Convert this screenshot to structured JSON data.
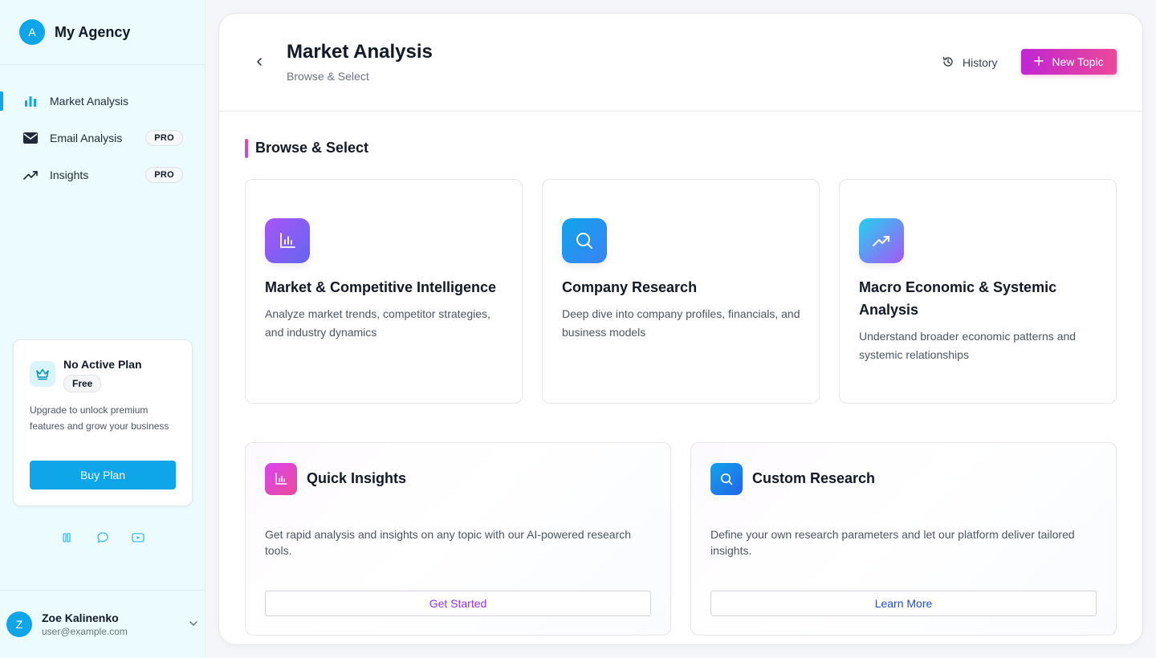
{
  "brand": {
    "initial": "A",
    "name": "My Agency"
  },
  "sidebar": {
    "items": [
      {
        "label": "Market Analysis",
        "icon": "bar-chart-icon",
        "active": true,
        "badge": ""
      },
      {
        "label": "Email Analysis",
        "icon": "mail-icon",
        "active": false,
        "badge": "PRO"
      },
      {
        "label": "Insights",
        "icon": "trending-up-icon",
        "active": false,
        "badge": "PRO"
      }
    ],
    "plan": {
      "title": "No Active Plan",
      "tier": "Free",
      "description": "Upgrade to unlock premium features and grow your business",
      "button": "Buy Plan"
    },
    "social_icons": [
      "library-icon",
      "chat-icon",
      "youtube-icon"
    ],
    "user": {
      "initial": "Z",
      "name": "Zoe Kalinenko",
      "email": "user@example.com"
    }
  },
  "header": {
    "title": "Market Analysis",
    "subtitle": "Browse & Select",
    "history_label": "History",
    "new_topic_label": "New Topic"
  },
  "section": {
    "title": "Browse & Select"
  },
  "cards": [
    {
      "title": "Market & Competitive Intelligence",
      "description": "Analyze market trends, competitor strategies, and industry dynamics",
      "icon": "bar-chart-icon"
    },
    {
      "title": "Company Research",
      "description": "Deep dive into company profiles, financials, and business models",
      "icon": "search-icon"
    },
    {
      "title": "Macro Economic & Systemic Analysis",
      "description": "Understand broader economic patterns and systemic relationships",
      "icon": "trending-up-icon"
    }
  ],
  "features": [
    {
      "title": "Quick Insights",
      "description": "Get rapid analysis and insights on any topic with our AI-powered research tools.",
      "button": "Get Started",
      "icon": "bar-chart-icon"
    },
    {
      "title": "Custom Research",
      "description": "Define your own research parameters and let our platform deliver tailored insights.",
      "button": "Learn More",
      "icon": "search-icon"
    }
  ],
  "colors": {
    "accent": "#0ea5e9",
    "sidebar_bg": "#ecfbfe",
    "gradient_pink": "#ec4899",
    "gradient_purple": "#a855f7",
    "get_started_text": "#9333ea",
    "learn_more_text": "#1d4ed8"
  }
}
